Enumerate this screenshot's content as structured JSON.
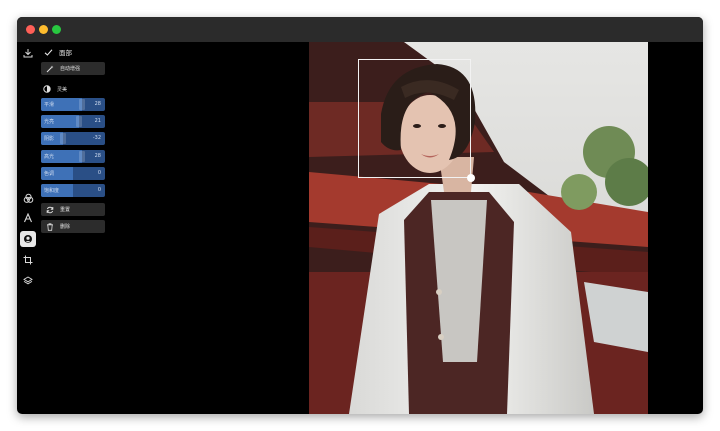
{
  "toolbar": {
    "tools": [
      {
        "icon": "download-icon"
      },
      {
        "icon": "color-filter-icon"
      },
      {
        "icon": "text-icon"
      },
      {
        "icon": "portrait-icon",
        "active": true
      },
      {
        "icon": "crop-icon"
      },
      {
        "icon": "layers-icon"
      }
    ]
  },
  "panel": {
    "header_label": "面部",
    "auto_enhance_label": "自动增强",
    "section_title": "灵美",
    "sliders": [
      {
        "label": "平滑",
        "value": 28,
        "fraction": 0.64
      },
      {
        "label": "光亮",
        "value": 21,
        "fraction": 0.6
      },
      {
        "label": "阴影",
        "value": -32,
        "fraction": 0.34
      },
      {
        "label": "高光",
        "value": 28,
        "fraction": 0.64
      },
      {
        "label": "色调",
        "value": 0,
        "fraction": 0.5
      },
      {
        "label": "饱和度",
        "value": 0,
        "fraction": 0.5
      }
    ],
    "reset_label": "重置",
    "delete_label": "删除"
  },
  "colors": {
    "accent": "#3e71b7",
    "slider_track": "#2a4f86",
    "button_bg": "#2c2c2c"
  }
}
